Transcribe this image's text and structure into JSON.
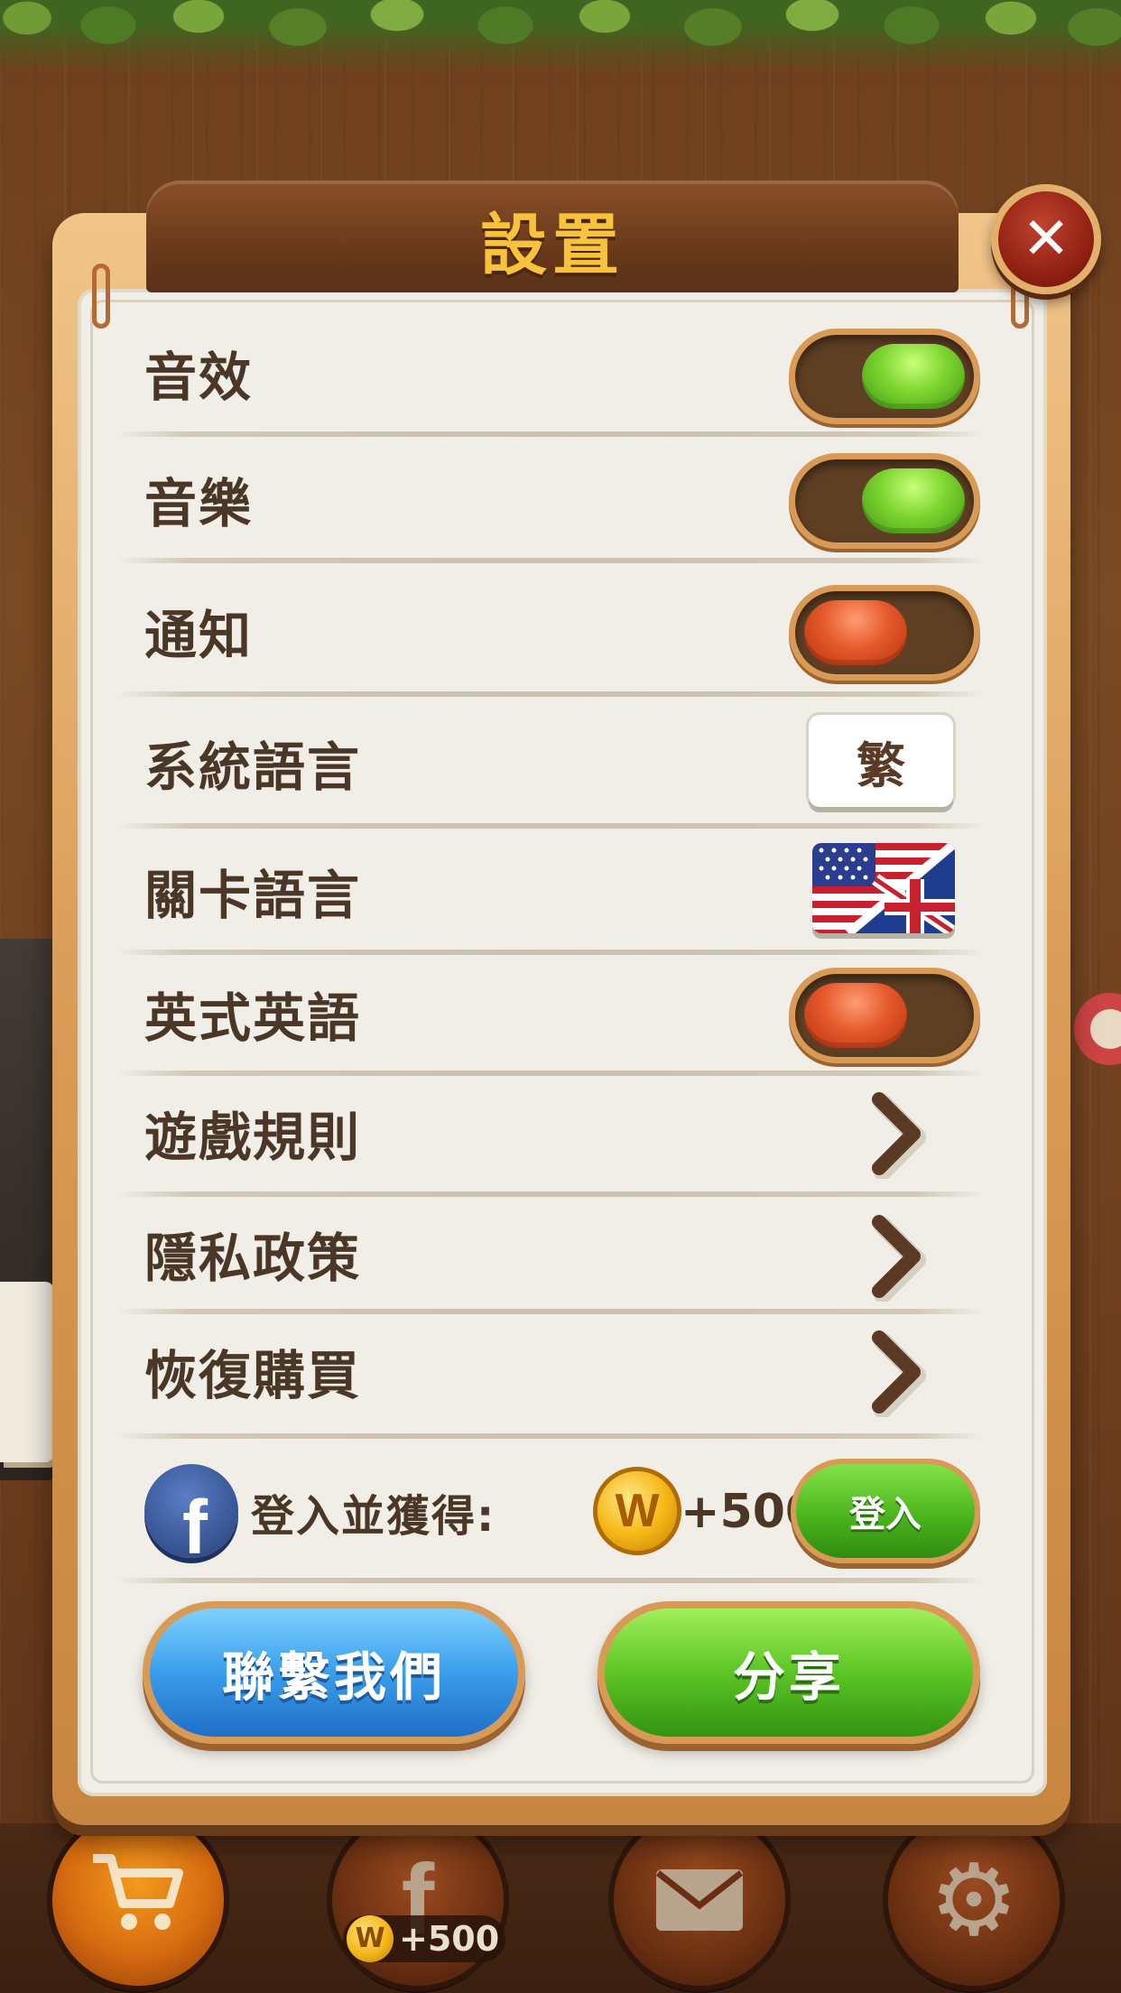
{
  "title": "設置",
  "rows": {
    "sound_effects": {
      "label": "音效",
      "state": "on"
    },
    "music": {
      "label": "音樂",
      "state": "on"
    },
    "notifications": {
      "label": "通知",
      "state": "off"
    },
    "system_language": {
      "label": "系統語言",
      "value": "繁"
    },
    "level_language": {
      "label": "關卡語言",
      "icon": "uk-us-flag-icon"
    },
    "british_english": {
      "label": "英式英語",
      "state": "off"
    },
    "game_rules": {
      "label": "遊戲規則"
    },
    "privacy_policy": {
      "label": "隱私政策"
    },
    "restore_purchases": {
      "label": "恢復購買"
    }
  },
  "facebook": {
    "icon_letter": "f",
    "prompt": "登入並獲得:",
    "coin_letter": "W",
    "reward": "+500",
    "login_label": "登入"
  },
  "buttons": {
    "contact_us": "聯繫我們",
    "share": "分享"
  },
  "bottom_bar": {
    "badge_coin_letter": "W",
    "badge_reward": "+500",
    "icons": [
      "cart-icon",
      "facebook-icon",
      "mail-icon",
      "gear-icon"
    ]
  },
  "colors": {
    "title": "#f6c33a",
    "toggle_on": "#7ed52f",
    "toggle_off": "#e65a2c",
    "panel_bg": "#f0eee6",
    "label_text": "#4a3728"
  }
}
